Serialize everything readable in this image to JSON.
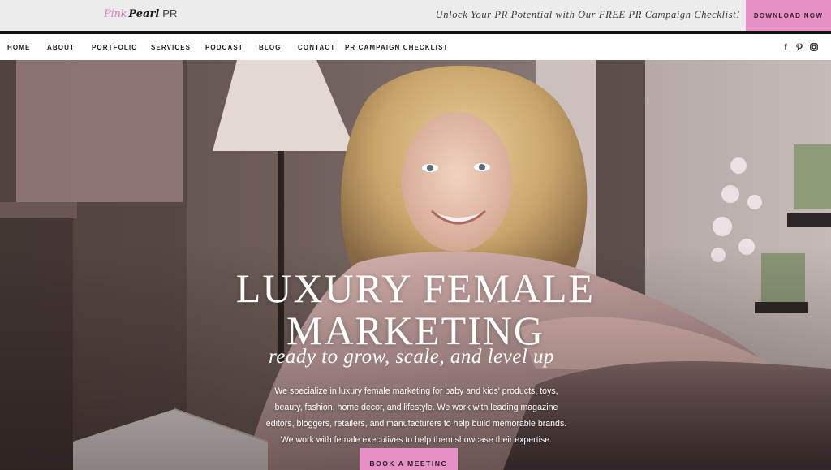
{
  "brand": {
    "logo_pink": "Pink",
    "logo_pearl": "Pearl",
    "logo_pr": "PR",
    "accent_color": "#e591c5"
  },
  "topbar": {
    "promo_text": "Unlock Your PR Potential with Our FREE PR Campaign Checklist!",
    "download_label": "DOWNLOAD NOW"
  },
  "nav": {
    "items": [
      {
        "label": "HOME"
      },
      {
        "label": "ABOUT"
      },
      {
        "label": "PORTFOLIO"
      },
      {
        "label": "SERVICES"
      },
      {
        "label": "PODCAST"
      },
      {
        "label": "BLOG"
      },
      {
        "label": "CONTACT"
      },
      {
        "label": "PR CAMPAIGN CHECKLIST"
      }
    ],
    "social": [
      {
        "icon": "facebook-icon",
        "glyph": "f"
      },
      {
        "icon": "pinterest-icon",
        "glyph": "p"
      },
      {
        "icon": "instagram-icon",
        "glyph": ""
      }
    ]
  },
  "hero": {
    "title_line1": "LUXURY FEMALE",
    "title_line2": "MARKETING",
    "subtitle": "ready to grow, scale, and level up",
    "body": "We specialize in luxury female marketing for baby and kids' products, toys, beauty, fashion, home decor, and lifestyle. We work with leading magazine editors, bloggers, retailers, and manufacturers to help build memorable brands. We work with female executives to help them showcase their expertise.",
    "cta_label": "BOOK A MEETING"
  }
}
